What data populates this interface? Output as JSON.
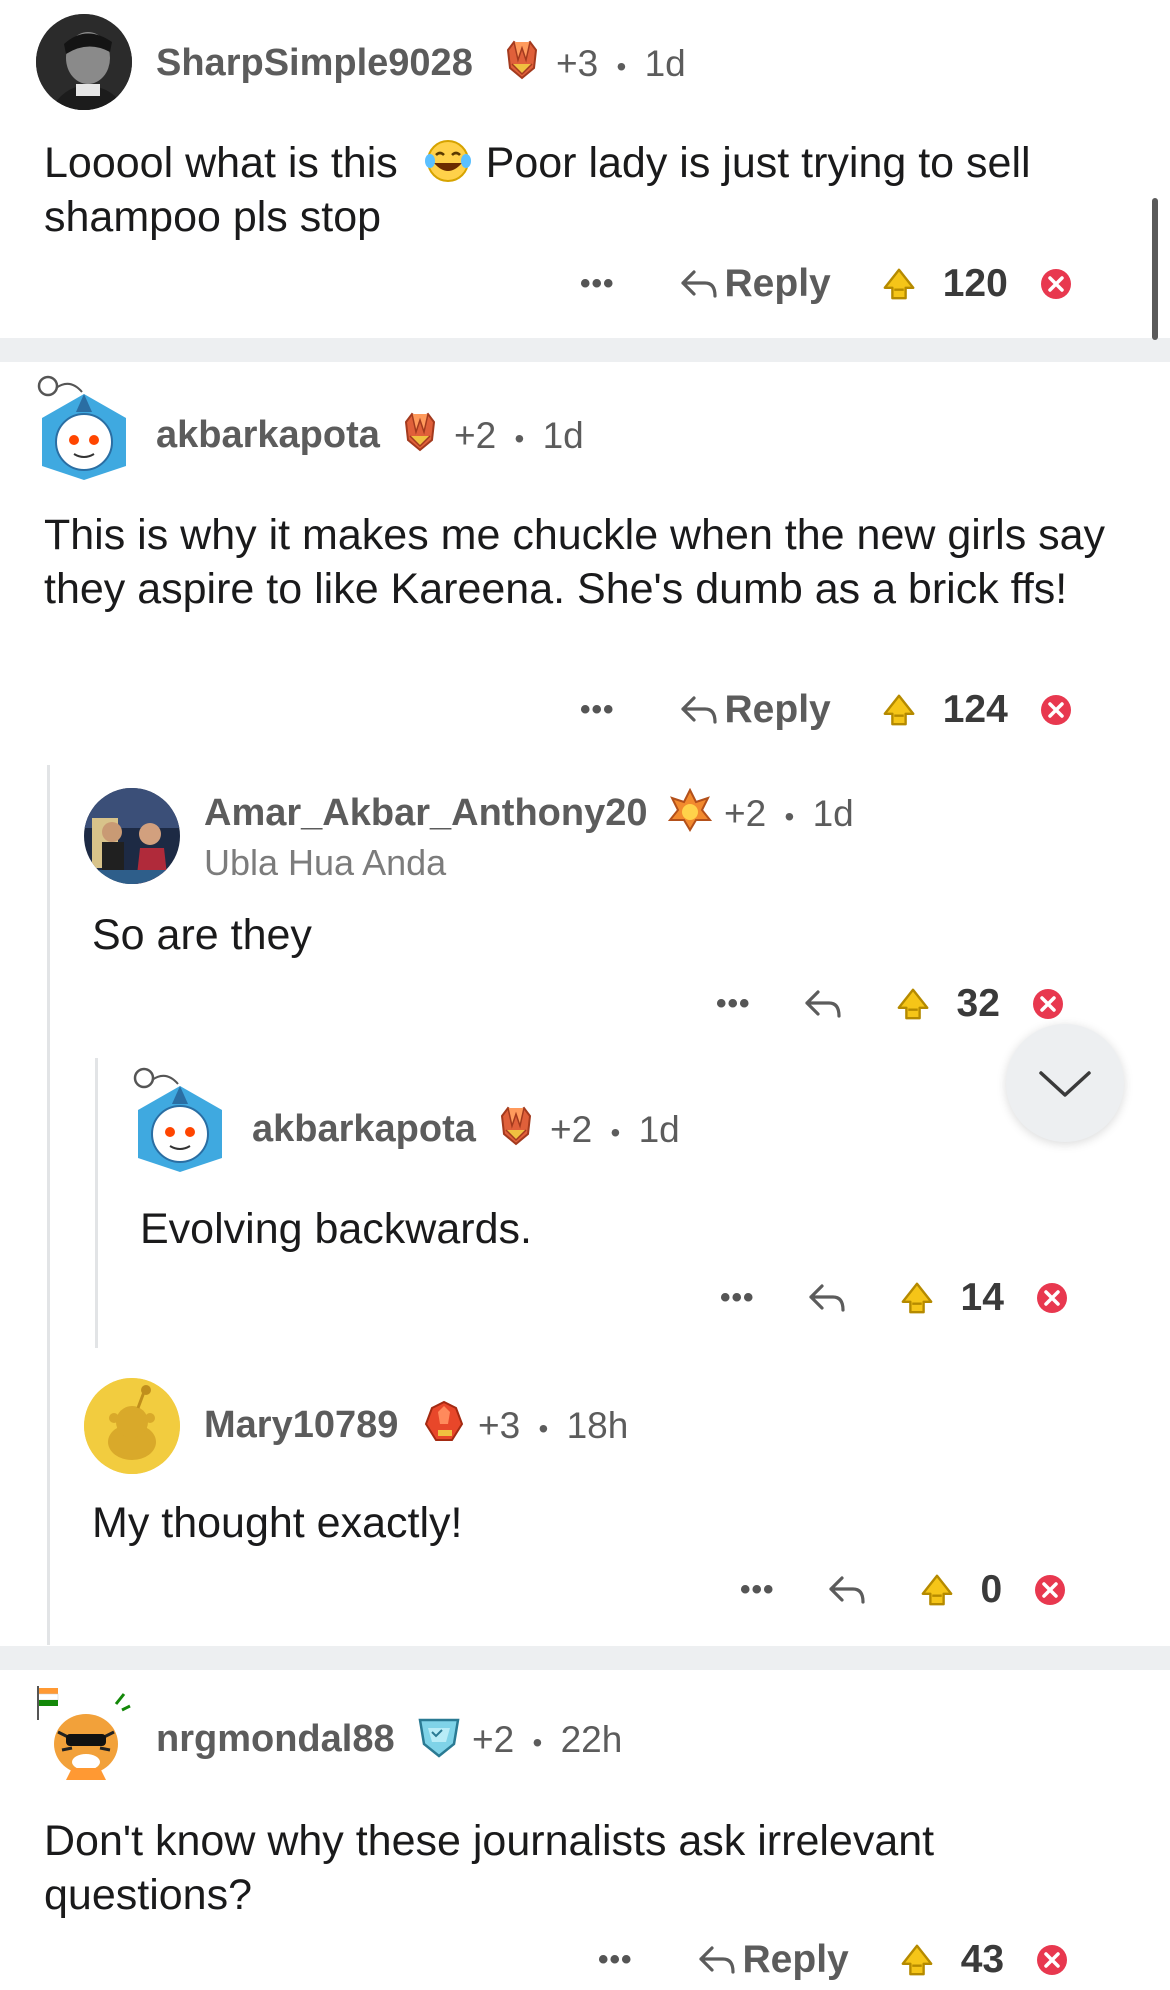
{
  "comments": [
    {
      "username": "SharpSimple9028",
      "karma": "+3",
      "age": "1d",
      "text_part1": "Looool what is this",
      "text_part2": " Poor lady is just trying to sell shampoo pls stop",
      "reply_label": "Reply",
      "votes": "120"
    },
    {
      "username": "akbarkapota",
      "karma": "+2",
      "age": "1d",
      "text": "This is why it makes me chuckle when the new girls say they aspire to like Kareena. She's dumb as a brick ffs!",
      "reply_label": "Reply",
      "votes": "124"
    },
    {
      "username": "Amar_Akbar_Anthony20",
      "flair": "Ubla Hua Anda",
      "karma": "+2",
      "age": "1d",
      "text": "So are they",
      "votes": "32"
    },
    {
      "username": "akbarkapota",
      "karma": "+2",
      "age": "1d",
      "text": "Evolving backwards.",
      "votes": "14"
    },
    {
      "username": "Mary10789",
      "karma": "+3",
      "age": "18h",
      "text": "My thought exactly!",
      "votes": "0"
    },
    {
      "username": "nrgmondal88",
      "karma": "+2",
      "age": "22h",
      "text": "Don't know why these journalists ask irrelevant questions?",
      "reply_label": "Reply",
      "votes": "43"
    }
  ],
  "dot_sep": "•",
  "more_dots": "•••",
  "colors": {
    "upvote_yellow": "#f5c518",
    "downvote_red": "#e8384f",
    "divider": "#edeff1"
  }
}
